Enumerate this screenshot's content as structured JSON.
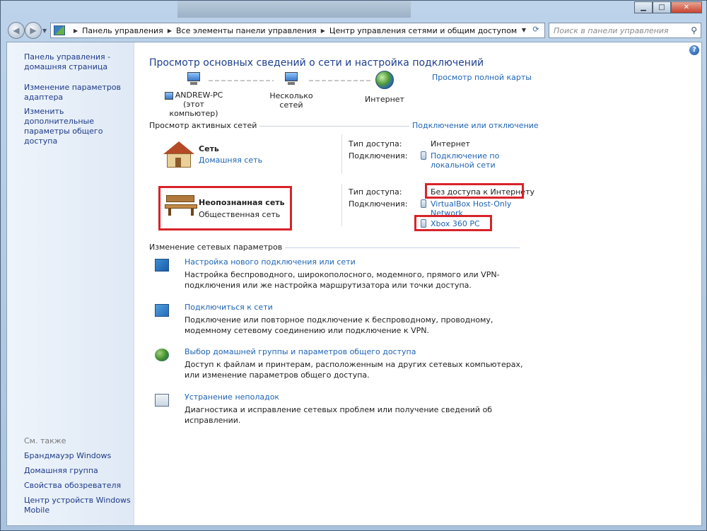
{
  "window": {
    "minimize": "▁",
    "maximize": "□",
    "close": "✕"
  },
  "nav": {
    "back": "◀",
    "forward": "▶",
    "dropdown": "▼"
  },
  "address": {
    "crumbs": [
      "Панель управления",
      "Все элементы панели управления",
      "Центр управления сетями и общим доступом"
    ],
    "separator": "▶",
    "dropdown": "▼",
    "refresh": "⟳"
  },
  "search": {
    "placeholder": "Поиск в панели управления",
    "icon": "⚲"
  },
  "sidebar": {
    "home": [
      "Панель управления -",
      "домашняя страница"
    ],
    "adapter": [
      "Изменение параметров",
      "адаптера"
    ],
    "sharing": [
      "Изменить дополнительные",
      "параметры общего доступа"
    ],
    "see_also": "См. также",
    "links": [
      "Брандмауэр Windows",
      "Домашняя группа",
      "Свойства обозревателя",
      "Центр устройств Windows",
      "Mobile"
    ]
  },
  "main": {
    "help": "?",
    "title": "Просмотр основных сведений о сети и настройка подключений",
    "full_map": "Просмотр полной карты",
    "map": {
      "pc_name": "ANDREW-PC",
      "pc_sub": "(этот компьютер)",
      "multiple": "Несколько сетей",
      "internet": "Интернет"
    },
    "active_label": "Просмотр активных сетей",
    "connect_link": "Подключение или отключение",
    "net1": {
      "name": "Сеть",
      "type": "Домашняя сеть",
      "access_label": "Тип доступа:",
      "access_value": "Интернет",
      "conn_label": "Подключения:",
      "conn_value": [
        "Подключение по",
        "локальной сети"
      ]
    },
    "net2": {
      "name": "Неопознанная сеть",
      "type": "Общественная сеть",
      "access_label": "Тип доступа:",
      "access_value": "Без доступа к Интернету",
      "conn_label": "Подключения:",
      "conn_value": [
        "VirtualBox Host-Only",
        "Network"
      ],
      "conn_value2": "Xbox 360 PC"
    },
    "change_label": "Изменение сетевых параметров",
    "tasks": [
      {
        "link": "Настройка нового подключения или сети",
        "desc": "Настройка беспроводного, широкополосного, модемного, прямого или VPN-подключения или же настройка маршрутизатора или точки доступа."
      },
      {
        "link": "Подключиться к сети",
        "desc": "Подключение или повторное подключение к беспроводному, проводному, модемному сетевому соединению или подключение к VPN."
      },
      {
        "link": "Выбор домашней группы и параметров общего доступа",
        "desc": "Доступ к файлам и принтерам, расположенным на других сетевых компьютерах, или изменение параметров общего доступа."
      },
      {
        "link": "Устранение неполадок",
        "desc": "Диагностика и исправление сетевых проблем или получение сведений об исправлении."
      }
    ]
  }
}
